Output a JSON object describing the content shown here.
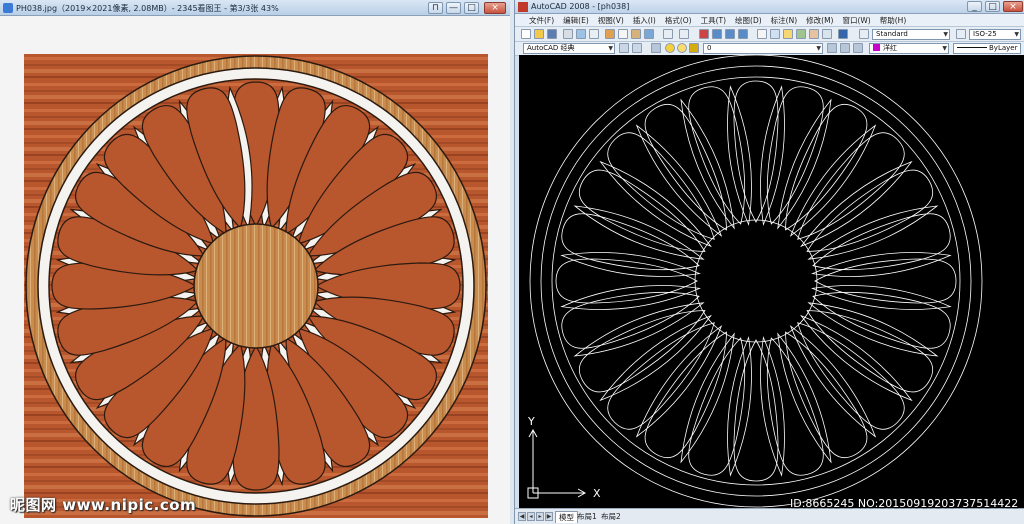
{
  "image_viewer": {
    "title": "PH038.jpg（2019×2021像素, 2.08MB）- 2345看图王 - 第3/3张 43%",
    "controls": {
      "pin": "⊓",
      "minimize": "—",
      "maximize": "□",
      "close": "×"
    }
  },
  "watermark": {
    "text": "昵图网 www.nipic.com"
  },
  "cad": {
    "title": "AutoCAD 2008 - [ph038]",
    "controls": {
      "minimize": "_",
      "maximize": "□",
      "close": "×"
    },
    "menus": [
      "文件(F)",
      "编辑(E)",
      "视图(V)",
      "插入(I)",
      "格式(O)",
      "工具(T)",
      "绘图(D)",
      "标注(N)",
      "修改(M)",
      "窗口(W)",
      "帮助(H)"
    ],
    "text_style": "Standard",
    "dim_style": "ISO-25",
    "workspace": "AutoCAD 经典",
    "layer": "0",
    "color": "洋红",
    "linetype": "ByLayer",
    "ucs": {
      "y_label": "Y",
      "x_label": "X"
    },
    "tabs": [
      "模型",
      "布局1",
      "布局2"
    ],
    "colors": {
      "drawing_background": "#000000",
      "linework": "#ffffff",
      "magenta_swatch": "#cc00cc"
    }
  },
  "id_overlay": {
    "text": "ID:8665245 NO:20150919203737514422"
  },
  "artwork": {
    "petal_count": 24,
    "colors": {
      "wood_red": "#b8562e",
      "wood_red_light": "#d17a4a",
      "marble_white": "#f5f3ef",
      "wood_gold": "#c98b4e",
      "outline": "#2b1a10"
    }
  }
}
